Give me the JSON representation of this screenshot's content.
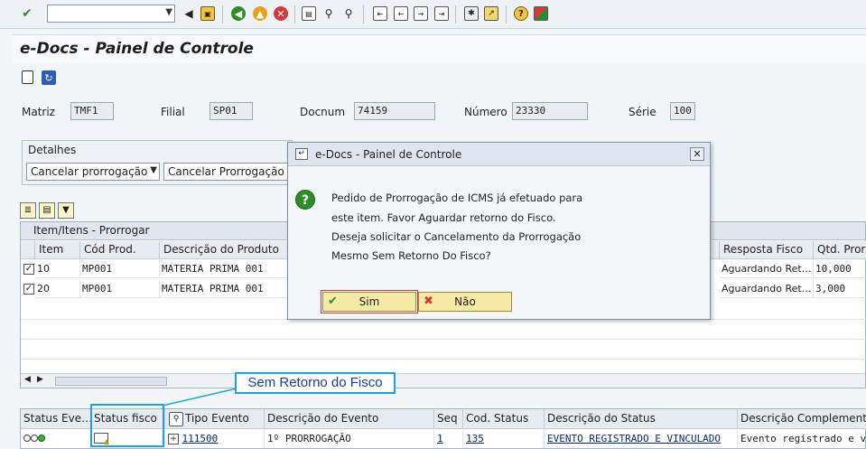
{
  "toolbar": {
    "command_field_value": "",
    "icons": [
      "enter-icon",
      "back-icon",
      "save-icon",
      "exit-icon",
      "cancel-icon",
      "print-icon",
      "find-icon",
      "find-next-icon",
      "first-page-icon",
      "prev-page-icon",
      "next-page-icon",
      "last-page-icon",
      "new-session-icon",
      "shortcut-icon",
      "help-icon",
      "layout-icon"
    ]
  },
  "title": "e-Docs - Painel de Controle",
  "header_fields": {
    "matriz_label": "Matriz",
    "matriz_value": "TMF1",
    "filial_label": "Filial",
    "filial_value": "SP01",
    "docnum_label": "Docnum",
    "docnum_value": "74159",
    "numero_label": "Número",
    "numero_value": "23330",
    "serie_label": "Série",
    "serie_value": "100"
  },
  "detalhes": {
    "title": "Detalhes",
    "action_select": "Cancelar prorrogação",
    "action_text": "Cancelar Prorrogação"
  },
  "items_grid": {
    "title": "Item/Itens - Prorrogar",
    "columns": [
      "Item",
      "Cód Prod.",
      "Descrição do Produto",
      "Resposta Fisco",
      "Qtd. Prorr"
    ],
    "rows": [
      {
        "checked": true,
        "item": "10",
        "cod": "MP001",
        "desc": "MATERIA PRIMA 001",
        "resposta": "Aguardando Ret…",
        "qtd": "10,000"
      },
      {
        "checked": true,
        "item": "20",
        "cod": "MP001",
        "desc": "MATERIA PRIMA 001",
        "resposta": "Aguardando Ret…",
        "qtd": "3,000"
      }
    ]
  },
  "events_grid": {
    "columns": [
      "Status Eve…",
      "Status fisco",
      "Tipo Evento",
      "Descrição do Evento",
      "Seq",
      "Cod. Status",
      "Descrição do Status",
      "Descrição Complementar"
    ],
    "row": {
      "tipo": "111500",
      "descricao": "1º PRORROGAÇÃO",
      "seq": "1",
      "cod_status": "135",
      "desc_status": "EVENTO REGISTRADO E VINCULADO",
      "desc_compl": "Evento registrado e v"
    }
  },
  "callout": {
    "label": "Sem Retorno do Fisco",
    "color": "#1ea2d8"
  },
  "dialog": {
    "title": "e-Docs - Painel de Controle",
    "lines": [
      "Pedido de Prorrogação de ICMS já efetuado para",
      "este item. Favor Aguardar retorno do Fisco.",
      "Deseja solicitar o Cancelamento da Prorrogação",
      "Mesmo Sem Retorno Do Fisco?"
    ],
    "yes_label": "Sim",
    "no_label": "Não"
  }
}
